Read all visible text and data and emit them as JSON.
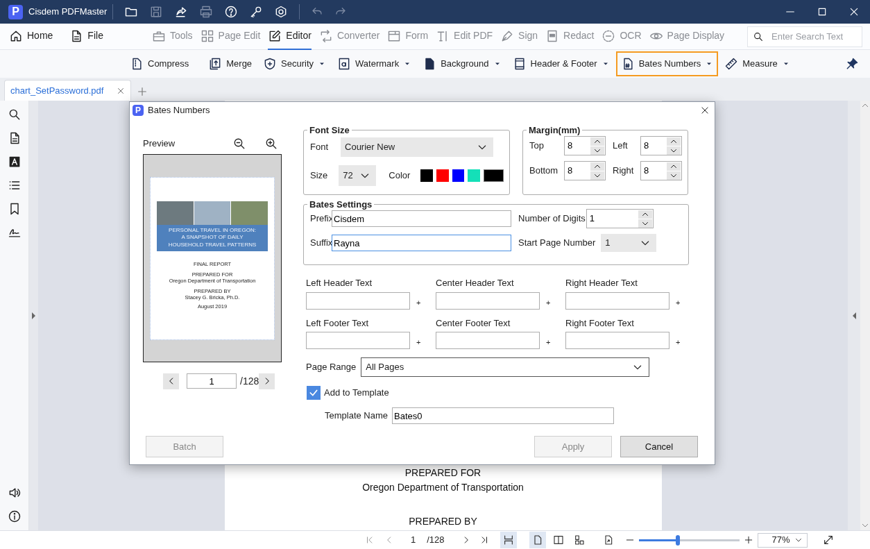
{
  "app": {
    "logo": "P",
    "title": "Cisdem PDFMaster"
  },
  "nav_left": [
    {
      "label": "Home"
    },
    {
      "label": "File"
    }
  ],
  "nav_tabs": [
    {
      "label": "Tools",
      "selected": false
    },
    {
      "label": "Page Edit",
      "selected": false
    },
    {
      "label": "Editor",
      "selected": true
    },
    {
      "label": "Converter",
      "selected": false
    },
    {
      "label": "Form",
      "selected": false
    },
    {
      "label": "Edit PDF",
      "selected": false
    },
    {
      "label": "Sign",
      "selected": false
    },
    {
      "label": "Redact",
      "selected": false
    },
    {
      "label": "OCR",
      "selected": false
    },
    {
      "label": "Page Display",
      "selected": false
    }
  ],
  "search": {
    "placeholder": "Enter Search Text"
  },
  "ribbon": [
    {
      "label": "Compress",
      "dropdown": false,
      "selected": false
    },
    {
      "label": "Merge",
      "dropdown": false,
      "selected": false
    },
    {
      "label": "Security",
      "dropdown": true,
      "selected": false
    },
    {
      "label": "Watermark",
      "dropdown": true,
      "selected": false
    },
    {
      "label": "Background",
      "dropdown": true,
      "selected": false
    },
    {
      "label": "Header & Footer",
      "dropdown": true,
      "selected": false
    },
    {
      "label": "Bates Numbers",
      "dropdown": true,
      "selected": true
    },
    {
      "label": "Measure",
      "dropdown": true,
      "selected": false
    }
  ],
  "document_tab": {
    "label": "chart_SetPassword.pdf"
  },
  "document_page": {
    "lines": [
      "PREPARED FOR",
      "Oregon Department of Transportation",
      "PREPARED BY"
    ]
  },
  "status_bar": {
    "page": "1",
    "total": "/128",
    "view_buttons": [
      {
        "selected": true
      },
      {
        "selected": true
      },
      {
        "selected": false
      },
      {
        "selected": false
      },
      {
        "selected": false
      }
    ],
    "zoom_slider": {
      "level": 0.39
    },
    "zoom": "77%"
  },
  "dialog": {
    "logo": "P",
    "title": "Bates Numbers",
    "preview": {
      "label": "Preview",
      "page": "1",
      "total": "/128",
      "cover_title": [
        "PERSONAL TRAVEL IN OREGON:",
        "A SNAPSHOT OF DAILY",
        "HOUSEHOLD TRAVEL PATTERNS"
      ],
      "lines": [
        "FINAL REPORT",
        "PREPARED FOR",
        "Oregon Department of Transportation",
        "PREPARED BY",
        "Stacey G. Bricka, Ph.D.",
        "August 2019"
      ]
    },
    "font_size": {
      "legend": "Font Size",
      "font_label": "Font",
      "font": "Courier New",
      "size_label": "Size",
      "size": "72",
      "color_label": "Color",
      "swatches": [
        {
          "color": "#000000"
        },
        {
          "color": "#ff0000"
        },
        {
          "color": "#0000ff"
        },
        {
          "color": "#14e0b8"
        }
      ],
      "current": {
        "color": "#000000"
      }
    },
    "margin": {
      "legend": "Margin(mm)",
      "fields": [
        {
          "label": "Top",
          "value": "8"
        },
        {
          "label": "Left",
          "value": "8"
        },
        {
          "label": "Bottom",
          "value": "8"
        },
        {
          "label": "Right",
          "value": "8"
        }
      ]
    },
    "bates": {
      "legend": "Bates Settings",
      "text_fields": [
        {
          "label": "Prefix",
          "value": "Cisdem",
          "focused": false
        },
        {
          "label": "Suffix",
          "value": "Rayna",
          "focused": true
        }
      ],
      "digits_label": "Number of Digits",
      "digits": "1",
      "start_label": "Start Page Number",
      "start": "1"
    },
    "header_footer": [
      {
        "label": "Left Header Text",
        "add": "+"
      },
      {
        "label": "Center Header Text",
        "add": "+"
      },
      {
        "label": "Right Header Text",
        "add": "+"
      },
      {
        "label": "Left Footer Text",
        "add": "+"
      },
      {
        "label": "Center Footer Text",
        "add": "+"
      },
      {
        "label": "Right Footer Text",
        "add": "+"
      }
    ],
    "page_range": {
      "label": "Page Range",
      "value": "All Pages"
    },
    "add_to_template": {
      "label": "Add to Template",
      "checked": true
    },
    "template_name": {
      "label": "Template Name",
      "value": "Bates0"
    },
    "buttons": [
      {
        "label": "Batch",
        "disabled": true
      },
      {
        "label": "Apply",
        "disabled": true
      },
      {
        "label": "Cancel",
        "disabled": false
      }
    ]
  }
}
